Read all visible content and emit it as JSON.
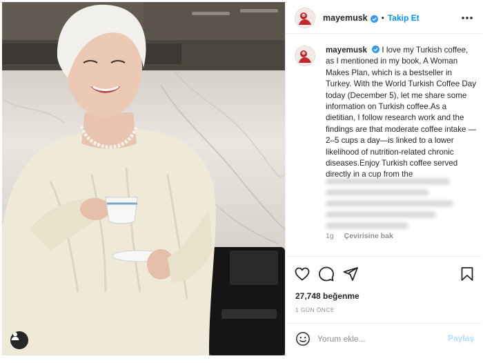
{
  "post": {
    "username": "mayemusk",
    "follow_label": "Takip Et",
    "separator": "•"
  },
  "caption": {
    "username": "mayemusk",
    "text": "I love my Turkish coffee, as I mentioned in my book, A Woman Makes Plan, which is a bestseller in Turkey. With the World Turkish Coffee Day today (December 5), let me share some information on Turkish coffee.As a dietitian, I follow research work and the findings are that moderate coffee intake — 2–5 cups a day—is linked to a lower likelihood of nutrition-related chronic diseases.Enjoy Turkish coffee served directly in a cup from the",
    "age": "1g",
    "translate_label": "Çevirisine bak"
  },
  "engagement": {
    "likes": "27,748 beğenme",
    "time_ago": "1 GÜN ÖNCE"
  },
  "comment": {
    "placeholder": "Yorum ekle...",
    "post_label": "Paylaş"
  },
  "icons": {
    "more": "more-horizontal-icon",
    "like": "heart-icon",
    "comment": "comment-icon",
    "share": "share-icon",
    "save": "bookmark-icon",
    "emoji": "emoji-icon",
    "verified": "verified-badge-icon",
    "tag": "user-tag-icon"
  },
  "colors": {
    "accent": "#0095f6",
    "verified": "#3897f0",
    "post_disabled": "#b2dffc",
    "muted": "#8e8e8e",
    "text": "#262626"
  }
}
